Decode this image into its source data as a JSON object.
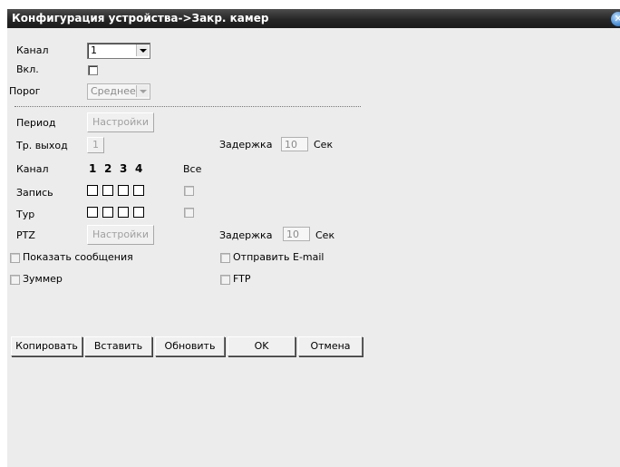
{
  "window": {
    "title": "Конфигурация устройства->Закр. камер"
  },
  "top": {
    "channel_label": "Канал",
    "channel_value": "1",
    "enable_label": "Вкл.",
    "threshold_label": "Порог",
    "threshold_value": "Среднее"
  },
  "period": {
    "label": "Период",
    "button": "Настройки"
  },
  "alarm_out": {
    "label": "Тр. выход",
    "value": "1",
    "delay_label": "Задержка",
    "delay_value": "10",
    "unit": "Сек"
  },
  "channels": {
    "label": "Канал",
    "numbers": [
      "1",
      "2",
      "3",
      "4"
    ],
    "all_label": "Все"
  },
  "record": {
    "label": "Запись"
  },
  "tour": {
    "label": "Тур"
  },
  "ptz": {
    "label": "PTZ",
    "button": "Настройки",
    "delay_label": "Задержка",
    "delay_value": "10",
    "unit": "Сек"
  },
  "options": {
    "show_message": "Показать сообщения",
    "send_email": "Отправить E-mail",
    "buzzer": "Зуммер",
    "ftp": "FTP"
  },
  "buttons": {
    "copy": "Копировать",
    "paste": "Вставить",
    "refresh": "Обновить",
    "ok": "OK",
    "cancel": "Отмена"
  }
}
